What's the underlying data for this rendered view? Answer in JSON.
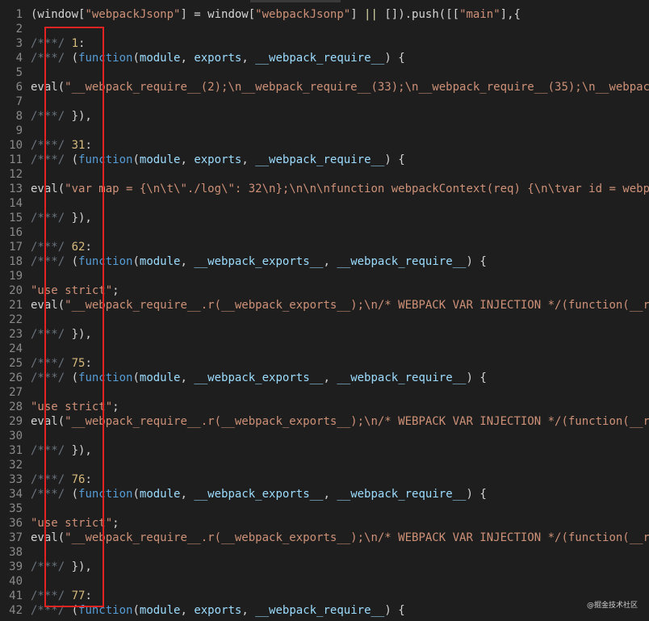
{
  "editor": {
    "lines": [
      {
        "n": "1",
        "segs": [
          {
            "t": "(window[",
            "c": "pl"
          },
          {
            "t": "\"webpackJsonp\"",
            "c": "str"
          },
          {
            "t": "] = window[",
            "c": "pl"
          },
          {
            "t": "\"webpackJsonp\"",
            "c": "str"
          },
          {
            "t": "] ",
            "c": "pl"
          },
          {
            "t": "||",
            "c": "or"
          },
          {
            "t": " []).push([[",
            "c": "pl"
          },
          {
            "t": "\"main\"",
            "c": "str"
          },
          {
            "t": "],{",
            "c": "pl"
          }
        ]
      },
      {
        "n": "2",
        "segs": []
      },
      {
        "n": "3",
        "segs": [
          {
            "t": "/***/ ",
            "c": "cm"
          },
          {
            "t": "1",
            "c": "num"
          },
          {
            "t": ":",
            "c": "pl"
          }
        ]
      },
      {
        "n": "4",
        "segs": [
          {
            "t": "/***/ ",
            "c": "cm"
          },
          {
            "t": "(",
            "c": "pl"
          },
          {
            "t": "function",
            "c": "kw"
          },
          {
            "t": "(",
            "c": "pl"
          },
          {
            "t": "module",
            "c": "id"
          },
          {
            "t": ", ",
            "c": "pl"
          },
          {
            "t": "exports",
            "c": "id"
          },
          {
            "t": ", ",
            "c": "pl"
          },
          {
            "t": "__webpack_require__",
            "c": "id"
          },
          {
            "t": ") {",
            "c": "pl"
          }
        ]
      },
      {
        "n": "5",
        "segs": []
      },
      {
        "n": "6",
        "segs": [
          {
            "t": "eval(",
            "c": "pl"
          },
          {
            "t": "\"__webpack_require__(2);\\n__webpack_require__(33);\\n__webpack_require__(35);\\n__webpack_",
            "c": "str"
          }
        ]
      },
      {
        "n": "7",
        "segs": []
      },
      {
        "n": "8",
        "segs": [
          {
            "t": "/***/ ",
            "c": "cm"
          },
          {
            "t": "}),",
            "c": "pl"
          }
        ]
      },
      {
        "n": "9",
        "segs": []
      },
      {
        "n": "10",
        "segs": [
          {
            "t": "/***/ ",
            "c": "cm"
          },
          {
            "t": "31",
            "c": "num"
          },
          {
            "t": ":",
            "c": "pl"
          }
        ]
      },
      {
        "n": "11",
        "segs": [
          {
            "t": "/***/ ",
            "c": "cm"
          },
          {
            "t": "(",
            "c": "pl"
          },
          {
            "t": "function",
            "c": "kw"
          },
          {
            "t": "(",
            "c": "pl"
          },
          {
            "t": "module",
            "c": "id"
          },
          {
            "t": ", ",
            "c": "pl"
          },
          {
            "t": "exports",
            "c": "id"
          },
          {
            "t": ", ",
            "c": "pl"
          },
          {
            "t": "__webpack_require__",
            "c": "id"
          },
          {
            "t": ") {",
            "c": "pl"
          }
        ]
      },
      {
        "n": "12",
        "segs": []
      },
      {
        "n": "13",
        "segs": [
          {
            "t": "eval(",
            "c": "pl"
          },
          {
            "t": "\"var map = {\\n\\t\\\"./log\\\": 32\\n};\\n\\n\\nfunction webpackContext(req) {\\n\\tvar id = webpac",
            "c": "str"
          }
        ]
      },
      {
        "n": "14",
        "segs": []
      },
      {
        "n": "15",
        "segs": [
          {
            "t": "/***/ ",
            "c": "cm"
          },
          {
            "t": "}),",
            "c": "pl"
          }
        ]
      },
      {
        "n": "16",
        "segs": []
      },
      {
        "n": "17",
        "segs": [
          {
            "t": "/***/ ",
            "c": "cm"
          },
          {
            "t": "62",
            "c": "num"
          },
          {
            "t": ":",
            "c": "pl"
          }
        ]
      },
      {
        "n": "18",
        "segs": [
          {
            "t": "/***/ ",
            "c": "cm"
          },
          {
            "t": "(",
            "c": "pl"
          },
          {
            "t": "function",
            "c": "kw"
          },
          {
            "t": "(",
            "c": "pl"
          },
          {
            "t": "module",
            "c": "id"
          },
          {
            "t": ", ",
            "c": "pl"
          },
          {
            "t": "__webpack_exports__",
            "c": "id"
          },
          {
            "t": ", ",
            "c": "pl"
          },
          {
            "t": "__webpack_require__",
            "c": "id"
          },
          {
            "t": ") {",
            "c": "pl"
          }
        ]
      },
      {
        "n": "19",
        "segs": []
      },
      {
        "n": "20",
        "segs": [
          {
            "t": "\"use strict\"",
            "c": "str"
          },
          {
            "t": ";",
            "c": "pl"
          }
        ]
      },
      {
        "n": "21",
        "segs": [
          {
            "t": "eval(",
            "c": "pl"
          },
          {
            "t": "\"__webpack_require__.r(__webpack_exports__);\\n/* WEBPACK VAR INJECTION */(function(__rea",
            "c": "str"
          }
        ]
      },
      {
        "n": "22",
        "segs": []
      },
      {
        "n": "23",
        "segs": [
          {
            "t": "/***/ ",
            "c": "cm"
          },
          {
            "t": "}),",
            "c": "pl"
          }
        ]
      },
      {
        "n": "24",
        "segs": []
      },
      {
        "n": "25",
        "segs": [
          {
            "t": "/***/ ",
            "c": "cm"
          },
          {
            "t": "75",
            "c": "num"
          },
          {
            "t": ":",
            "c": "pl"
          }
        ]
      },
      {
        "n": "26",
        "segs": [
          {
            "t": "/***/ ",
            "c": "cm"
          },
          {
            "t": "(",
            "c": "pl"
          },
          {
            "t": "function",
            "c": "kw"
          },
          {
            "t": "(",
            "c": "pl"
          },
          {
            "t": "module",
            "c": "id"
          },
          {
            "t": ", ",
            "c": "pl"
          },
          {
            "t": "__webpack_exports__",
            "c": "id"
          },
          {
            "t": ", ",
            "c": "pl"
          },
          {
            "t": "__webpack_require__",
            "c": "id"
          },
          {
            "t": ") {",
            "c": "pl"
          }
        ]
      },
      {
        "n": "27",
        "segs": []
      },
      {
        "n": "28",
        "segs": [
          {
            "t": "\"use strict\"",
            "c": "str"
          },
          {
            "t": ";",
            "c": "pl"
          }
        ]
      },
      {
        "n": "29",
        "segs": [
          {
            "t": "eval(",
            "c": "pl"
          },
          {
            "t": "\"__webpack_require__.r(__webpack_exports__);\\n/* WEBPACK VAR INJECTION */(function(__rea",
            "c": "str"
          }
        ]
      },
      {
        "n": "30",
        "segs": []
      },
      {
        "n": "31",
        "segs": [
          {
            "t": "/***/ ",
            "c": "cm"
          },
          {
            "t": "}),",
            "c": "pl"
          }
        ]
      },
      {
        "n": "32",
        "segs": []
      },
      {
        "n": "33",
        "segs": [
          {
            "t": "/***/ ",
            "c": "cm"
          },
          {
            "t": "76",
            "c": "num"
          },
          {
            "t": ":",
            "c": "pl"
          }
        ]
      },
      {
        "n": "34",
        "segs": [
          {
            "t": "/***/ ",
            "c": "cm"
          },
          {
            "t": "(",
            "c": "pl"
          },
          {
            "t": "function",
            "c": "kw"
          },
          {
            "t": "(",
            "c": "pl"
          },
          {
            "t": "module",
            "c": "id"
          },
          {
            "t": ", ",
            "c": "pl"
          },
          {
            "t": "__webpack_exports__",
            "c": "id"
          },
          {
            "t": ", ",
            "c": "pl"
          },
          {
            "t": "__webpack_require__",
            "c": "id"
          },
          {
            "t": ") {",
            "c": "pl"
          }
        ]
      },
      {
        "n": "35",
        "segs": []
      },
      {
        "n": "36",
        "segs": [
          {
            "t": "\"use strict\"",
            "c": "str"
          },
          {
            "t": ";",
            "c": "pl"
          }
        ]
      },
      {
        "n": "37",
        "segs": [
          {
            "t": "eval(",
            "c": "pl"
          },
          {
            "t": "\"__webpack_require__.r(__webpack_exports__);\\n/* WEBPACK VAR INJECTION */(function(__rea",
            "c": "str"
          }
        ]
      },
      {
        "n": "38",
        "segs": []
      },
      {
        "n": "39",
        "segs": [
          {
            "t": "/***/ ",
            "c": "cm"
          },
          {
            "t": "}),",
            "c": "pl"
          }
        ]
      },
      {
        "n": "40",
        "segs": []
      },
      {
        "n": "41",
        "segs": [
          {
            "t": "/***/ ",
            "c": "cm"
          },
          {
            "t": "77",
            "c": "num"
          },
          {
            "t": ":",
            "c": "pl"
          }
        ]
      },
      {
        "n": "42",
        "segs": [
          {
            "t": "/***/ ",
            "c": "cm"
          },
          {
            "t": "(",
            "c": "pl"
          },
          {
            "t": "function",
            "c": "kw"
          },
          {
            "t": "(",
            "c": "pl"
          },
          {
            "t": "module",
            "c": "id"
          },
          {
            "t": ", ",
            "c": "pl"
          },
          {
            "t": "exports",
            "c": "id"
          },
          {
            "t": ", ",
            "c": "pl"
          },
          {
            "t": "__webpack_require__",
            "c": "id"
          },
          {
            "t": ") {",
            "c": "pl"
          }
        ]
      }
    ]
  },
  "highlight": {
    "color": "#e32222"
  },
  "theme": {
    "background": "#1e1e1e",
    "line_number": "#8a8a8a",
    "comment": "#6a737d",
    "number": "#d7ba7d",
    "keyword": "#569cd6",
    "identifier": "#9cdcfe",
    "string": "#ce9178",
    "plain": "#d4d4d4"
  },
  "watermark": {
    "text": "@掘金技术社区"
  }
}
